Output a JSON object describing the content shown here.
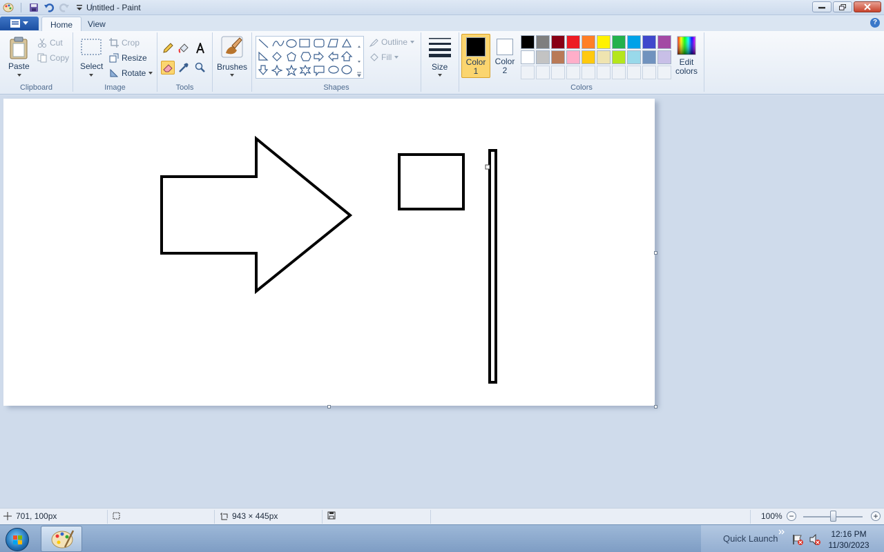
{
  "window": {
    "title": "Untitled - Paint"
  },
  "tabs": {
    "home": "Home",
    "view": "View"
  },
  "help_label": "?",
  "clipboard": {
    "paste": "Paste",
    "cut": "Cut",
    "copy": "Copy",
    "group": "Clipboard"
  },
  "image": {
    "select": "Select",
    "crop": "Crop",
    "resize": "Resize",
    "rotate": "Rotate",
    "group": "Image"
  },
  "tools": {
    "group": "Tools"
  },
  "brushes": {
    "label": "Brushes"
  },
  "shapes": {
    "outline": "Outline",
    "fill": "Fill",
    "group": "Shapes"
  },
  "size": {
    "label": "Size"
  },
  "colors": {
    "color1": "Color 1",
    "color1_value": "#000000",
    "color2": "Color 2",
    "color2_value": "#ffffff",
    "edit": "Edit colors",
    "group": "Colors",
    "palette": [
      "#000000",
      "#7f7f7f",
      "#880015",
      "#ed1c24",
      "#ff7f27",
      "#fff200",
      "#22b14c",
      "#00a2e8",
      "#3f48cc",
      "#a349a4",
      "#ffffff",
      "#c3c3c3",
      "#b97a57",
      "#ffaec9",
      "#ffc90e",
      "#efe4b0",
      "#b5e61d",
      "#99d9ea",
      "#7092be",
      "#c8bfe7",
      "",
      "",
      "",
      "",
      "",
      "",
      "",
      "",
      "",
      ""
    ]
  },
  "status": {
    "cursor": "701, 100px",
    "size": "943 × 445px",
    "zoom": "100%"
  },
  "taskbar": {
    "quick_launch": "Quick Launch",
    "time": "12:16 PM",
    "date": "11/30/2023"
  }
}
